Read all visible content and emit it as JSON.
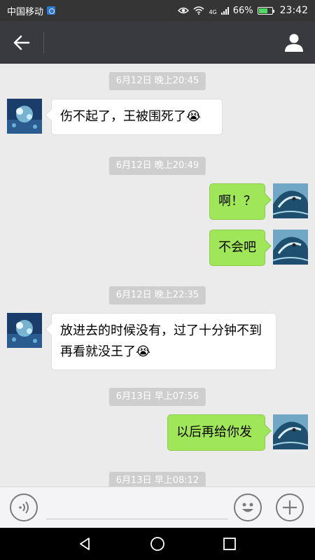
{
  "status_bar": {
    "carrier": "中国移动",
    "network": "4G",
    "battery": "66%",
    "battery_level": 0.66,
    "time": "23:42"
  },
  "nav": {
    "title": "",
    "icons": [
      "back-arrow-icon",
      "person-icon"
    ]
  },
  "messages": [
    {
      "type": "timestamp",
      "text": "6月12日 晚上20:45"
    },
    {
      "type": "incoming",
      "text": "伤不起了，王被围死了",
      "emoji": "😭"
    },
    {
      "type": "timestamp",
      "text": "6月12日 晚上20:49"
    },
    {
      "type": "outgoing",
      "text": "啊！？"
    },
    {
      "type": "outgoing",
      "text": "不会吧"
    },
    {
      "type": "timestamp",
      "text": "6月12日 晚上22:35"
    },
    {
      "type": "incoming",
      "text": "放进去的时候没有，过了十分钟不到再看就没王了",
      "emoji": "😭"
    },
    {
      "type": "timestamp",
      "text": "6月13日 早上07:56"
    },
    {
      "type": "outgoing",
      "text": "以后再给你发"
    },
    {
      "type": "timestamp",
      "text": "6月13日 早上08:12"
    }
  ],
  "input_bar": {
    "value": "",
    "icons": [
      "voice-icon",
      "emoji-icon",
      "plus-icon"
    ]
  },
  "system_nav": {
    "icons": [
      "back-triangle-icon",
      "home-circle-icon",
      "recents-square-icon"
    ]
  },
  "colors": {
    "header": "#393a3f",
    "outgoing_bubble": "#9fe658",
    "incoming_bubble": "#ffffff",
    "chat_bg": "#ebebeb"
  }
}
